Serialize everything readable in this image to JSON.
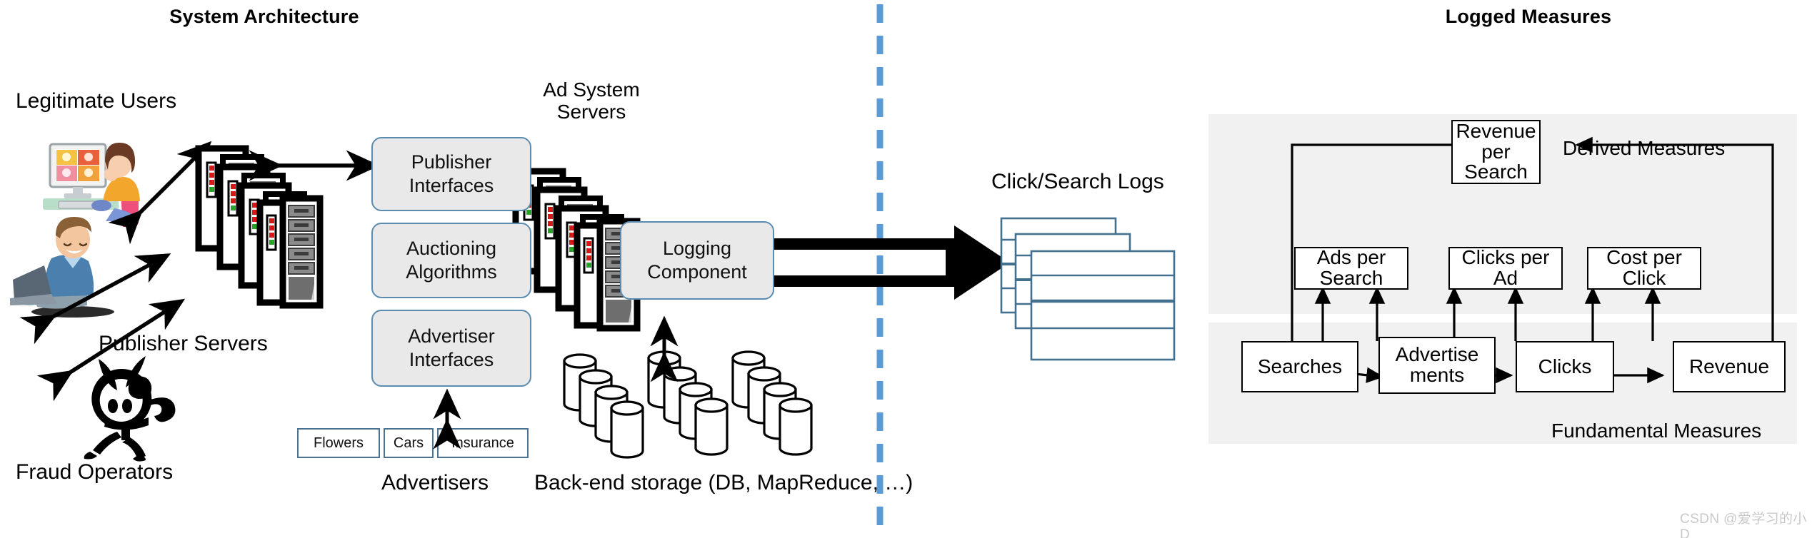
{
  "titles": {
    "left": "System Architecture",
    "right": "Logged Measures"
  },
  "left_panel": {
    "legitimate_users_label": "Legitimate Users",
    "fraud_operators_label": "Fraud Operators",
    "publisher_servers_label": "Publisher Servers",
    "ad_system_servers_label": "Ad System\nServers",
    "ad_system_servers_line1": "Ad System",
    "ad_system_servers_line2": "Servers",
    "advertisers_label": "Advertisers",
    "backend_storage_label": "Back-end storage (DB, MapReduce, …)",
    "process_boxes": [
      {
        "id": "publisher-interfaces",
        "line1": "Publisher",
        "line2": "Interfaces"
      },
      {
        "id": "auctioning-algorithms",
        "line1": "Auctioning",
        "line2": "Algorithms"
      },
      {
        "id": "advertiser-interfaces",
        "line1": "Advertiser",
        "line2": "Interfaces"
      },
      {
        "id": "logging-component",
        "line1": "Logging",
        "line2": "Component"
      }
    ],
    "advertiser_tiles": [
      {
        "id": "flowers",
        "label": "Flowers"
      },
      {
        "id": "cars",
        "label": "Cars"
      },
      {
        "id": "insurance",
        "label": "Insurance"
      }
    ]
  },
  "logs": {
    "label": "Click/Search Logs"
  },
  "right_panel": {
    "derived_measures_label": "Derived Measures",
    "fundamental_measures_label": "Fundamental Measures",
    "top_box": {
      "id": "revenue-per-search",
      "line1": "Revenue",
      "line2": "per Search"
    },
    "derived_boxes": [
      {
        "id": "ads-per-search",
        "line1": "Ads per",
        "line2": "Search"
      },
      {
        "id": "clicks-per-ad",
        "line1": "Clicks per",
        "line2": "Ad"
      },
      {
        "id": "cost-per-click",
        "line1": "Cost per",
        "line2": "Click"
      }
    ],
    "fundamental_boxes": [
      {
        "id": "searches",
        "line1": "Searches",
        "line2": ""
      },
      {
        "id": "advertisements",
        "line1": "Advertise",
        "line2": "ments"
      },
      {
        "id": "clicks",
        "line1": "Clicks",
        "line2": ""
      },
      {
        "id": "revenue",
        "line1": "Revenue",
        "line2": ""
      }
    ]
  },
  "watermark": {
    "text": "CSDN @爱学习的小D"
  },
  "colors": {
    "divider": "#5b9bd5",
    "box_border": "#5b8cb0",
    "box_fill": "#e9e9e9",
    "panel_fill": "#f1f1f1",
    "log_border": "#44708f",
    "arrow": "#000000"
  }
}
